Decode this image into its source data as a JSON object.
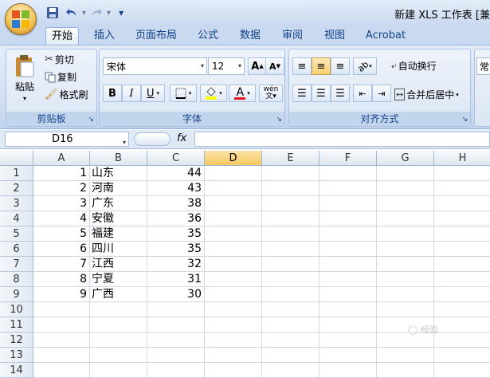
{
  "titlebar": {
    "title": "新建 XLS 工作表 [兼",
    "qat": {
      "save_icon": "save-icon",
      "undo_icon": "undo-icon",
      "redo_icon": "redo-icon",
      "customize": "▾"
    }
  },
  "tabs": [
    {
      "label": "开始",
      "active": true
    },
    {
      "label": "插入"
    },
    {
      "label": "页面布局"
    },
    {
      "label": "公式"
    },
    {
      "label": "数据"
    },
    {
      "label": "审阅"
    },
    {
      "label": "视图"
    },
    {
      "label": "Acrobat"
    }
  ],
  "clipboard": {
    "group_label": "剪贴板",
    "paste": "粘贴",
    "cut": "剪切",
    "copy": "复制",
    "format_painter": "格式刷"
  },
  "font": {
    "group_label": "字体",
    "font_name": "宋体",
    "font_size": "12",
    "grow": "A",
    "shrink": "A",
    "bold": "B",
    "italic": "I",
    "underline": "U",
    "phonetic": "wén",
    "font_color": "#e31b1b",
    "fill_color": "#ffff00"
  },
  "alignment": {
    "group_label": "对齐方式",
    "wrap_text": "自动换行",
    "merge_center": "合并后居中"
  },
  "number": {
    "format_partial": "常"
  },
  "formula_bar": {
    "name_box": "D16",
    "fx": "fx",
    "content": ""
  },
  "sheet": {
    "columns": [
      "A",
      "B",
      "C",
      "D",
      "E",
      "F",
      "G",
      "H"
    ],
    "selected_column": "D",
    "rows": [
      {
        "n": "1",
        "a": "1",
        "b": "山东",
        "c": "44"
      },
      {
        "n": "2",
        "a": "2",
        "b": "河南",
        "c": "43"
      },
      {
        "n": "3",
        "a": "3",
        "b": "广东",
        "c": "38"
      },
      {
        "n": "4",
        "a": "4",
        "b": "安徽",
        "c": "36"
      },
      {
        "n": "5",
        "a": "5",
        "b": "福建",
        "c": "35"
      },
      {
        "n": "6",
        "a": "6",
        "b": "四川",
        "c": "35"
      },
      {
        "n": "7",
        "a": "7",
        "b": "江西",
        "c": "32"
      },
      {
        "n": "8",
        "a": "8",
        "b": "宁夏",
        "c": "31"
      },
      {
        "n": "9",
        "a": "9",
        "b": "广西",
        "c": "30"
      },
      {
        "n": "10",
        "a": "",
        "b": "",
        "c": ""
      },
      {
        "n": "11",
        "a": "",
        "b": "",
        "c": ""
      },
      {
        "n": "12",
        "a": "",
        "b": "",
        "c": ""
      },
      {
        "n": "13",
        "a": "",
        "b": "",
        "c": ""
      },
      {
        "n": "14",
        "a": "",
        "b": "",
        "c": ""
      }
    ]
  }
}
